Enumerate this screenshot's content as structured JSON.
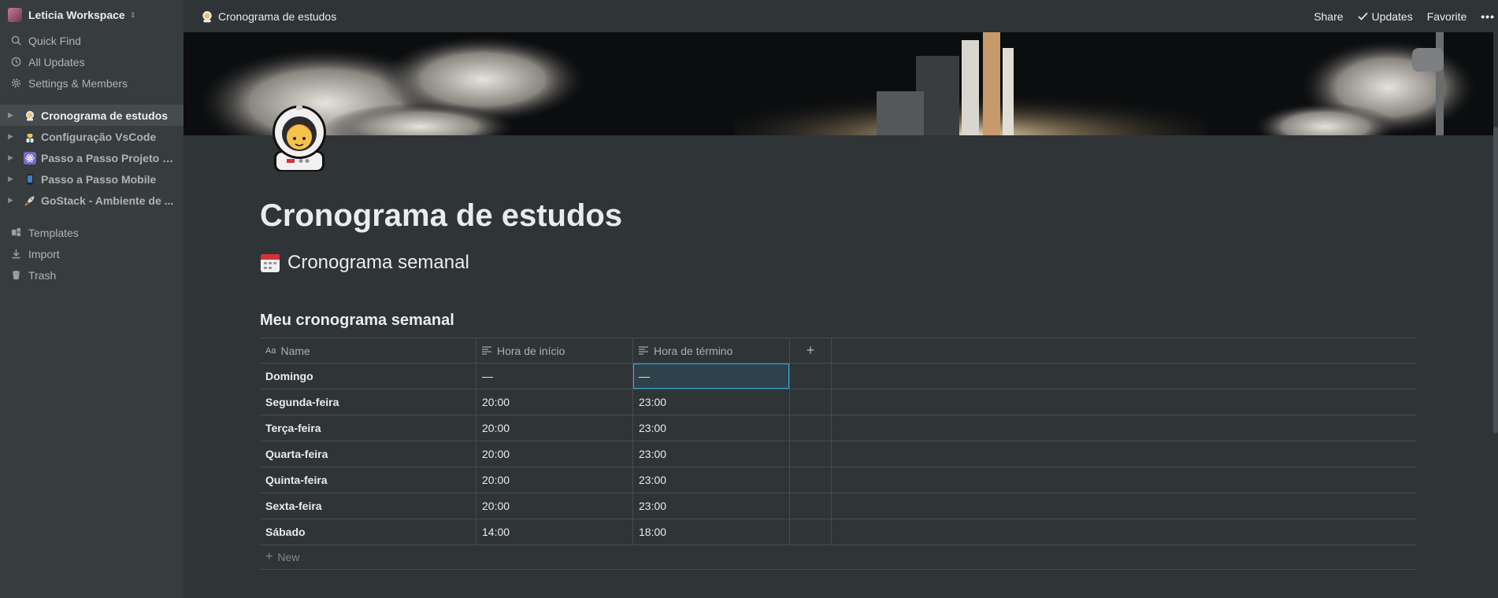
{
  "sidebar": {
    "workspace": "Leticia Workspace",
    "nav": [
      {
        "label": "Quick Find",
        "icon": "search-icon"
      },
      {
        "label": "All Updates",
        "icon": "clock-icon"
      },
      {
        "label": "Settings & Members",
        "icon": "gear-icon"
      }
    ],
    "pages": [
      {
        "label": "Cronograma de estudos",
        "icon": "astronaut-icon",
        "active": true
      },
      {
        "label": "Configuração VsCode",
        "icon": "scientist-icon"
      },
      {
        "label": "Passo a Passo Projeto R...",
        "icon": "atom-icon"
      },
      {
        "label": "Passo a Passo Mobile",
        "icon": "phone-icon"
      },
      {
        "label": "GoStack - Ambiente de ...",
        "icon": "rocket-icon"
      }
    ],
    "bottom": [
      {
        "label": "Templates",
        "icon": "templates-icon"
      },
      {
        "label": "Import",
        "icon": "import-icon"
      },
      {
        "label": "Trash",
        "icon": "trash-icon"
      }
    ]
  },
  "topbar": {
    "breadcrumb": "Cronograma de estudos",
    "share": "Share",
    "updates": "Updates",
    "favorite": "Favorite",
    "more": "•••"
  },
  "page": {
    "title": "Cronograma de estudos",
    "heading": "Cronograma semanal",
    "database_title": "Meu cronograma semanal"
  },
  "table": {
    "columns": [
      "Name",
      "Hora de início",
      "Hora de término"
    ],
    "add_column": "+",
    "rows": [
      {
        "name": "Domingo",
        "start": "—",
        "end": "—"
      },
      {
        "name": "Segunda-feira",
        "start": "20:00",
        "end": "23:00"
      },
      {
        "name": "Terça-feira",
        "start": "20:00",
        "end": "23:00"
      },
      {
        "name": "Quarta-feira",
        "start": "20:00",
        "end": "23:00"
      },
      {
        "name": "Quinta-feira",
        "start": "20:00",
        "end": "23:00"
      },
      {
        "name": "Sexta-feira",
        "start": "20:00",
        "end": "23:00"
      },
      {
        "name": "Sábado",
        "start": "14:00",
        "end": "18:00"
      }
    ],
    "new_label": "New"
  },
  "colors": {
    "background": "#2f3437",
    "sidebar": "#373c3f",
    "selection": "#2eaadc"
  }
}
